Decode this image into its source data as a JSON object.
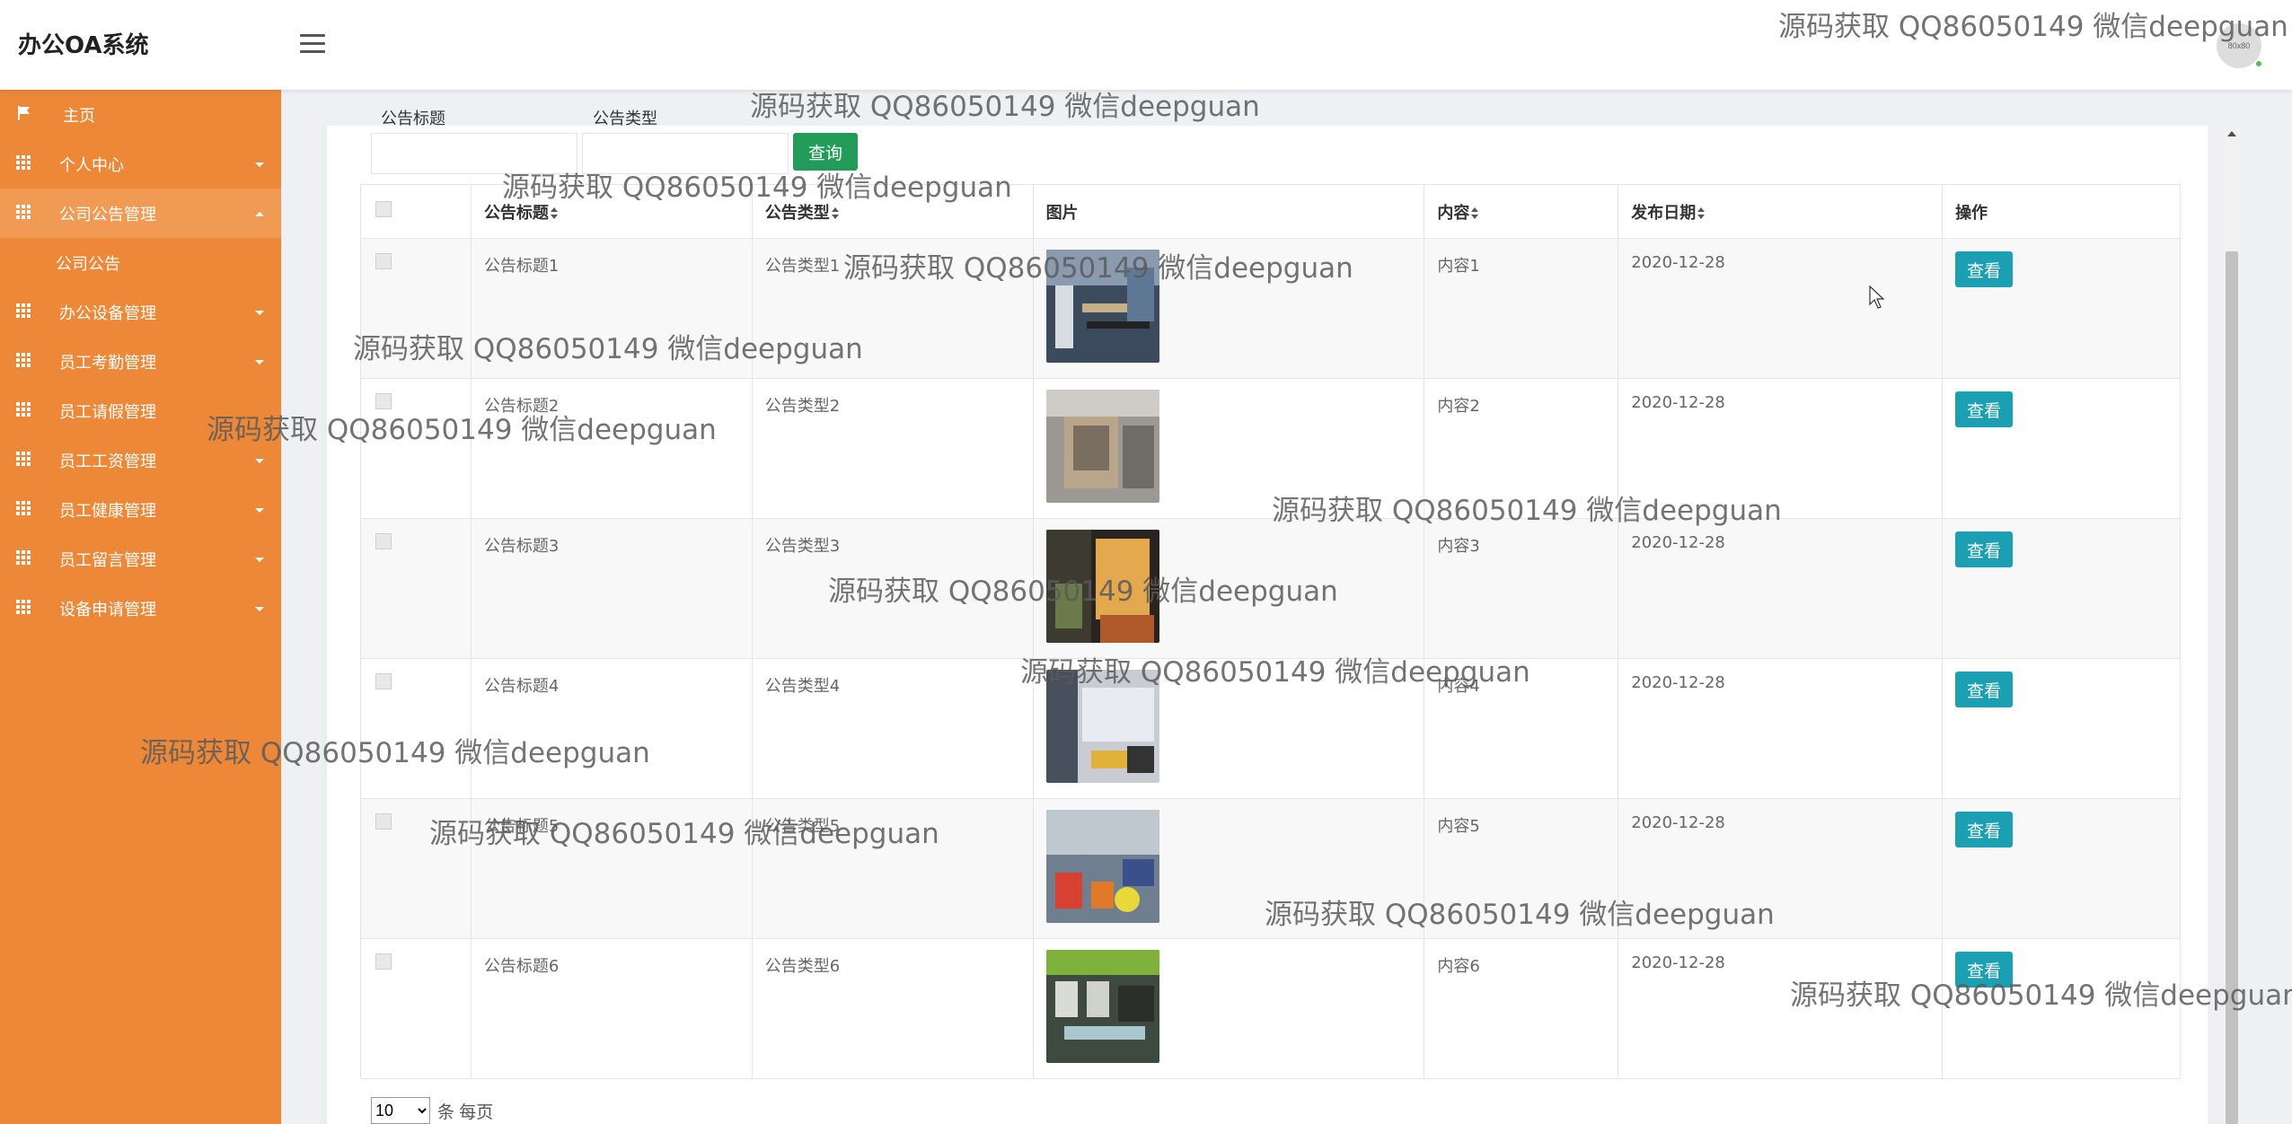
{
  "app": {
    "title": "办公OA系统",
    "avatar_text": "80x80"
  },
  "sidebar": {
    "items": [
      {
        "label": "主页",
        "icon": "flag-icon",
        "expandable": false,
        "active": false
      },
      {
        "label": "个人中心",
        "icon": "grid-icon",
        "expandable": true,
        "active": false
      },
      {
        "label": "公司公告管理",
        "icon": "grid-icon",
        "expandable": true,
        "active": true,
        "expanded": true
      },
      {
        "label": "办公设备管理",
        "icon": "grid-icon",
        "expandable": true,
        "active": false
      },
      {
        "label": "员工考勤管理",
        "icon": "grid-icon",
        "expandable": true,
        "active": false
      },
      {
        "label": "员工请假管理",
        "icon": "grid-icon",
        "expandable": false,
        "active": false
      },
      {
        "label": "员工工资管理",
        "icon": "grid-icon",
        "expandable": true,
        "active": false
      },
      {
        "label": "员工健康管理",
        "icon": "grid-icon",
        "expandable": true,
        "active": false
      },
      {
        "label": "员工留言管理",
        "icon": "grid-icon",
        "expandable": true,
        "active": false
      },
      {
        "label": "设备申请管理",
        "icon": "grid-icon",
        "expandable": true,
        "active": false
      }
    ],
    "subitem": "公司公告"
  },
  "search": {
    "label1": "公告标题",
    "label2": "公告类型",
    "query_label": "查询"
  },
  "table": {
    "columns": [
      "公告标题",
      "公告类型",
      "图片",
      "内容",
      "发布日期",
      "操作"
    ],
    "rows": [
      {
        "title": "公告标题1",
        "type": "公告类型1",
        "content": "内容1",
        "date": "2020-12-28",
        "action": "查看"
      },
      {
        "title": "公告标题2",
        "type": "公告类型2",
        "content": "内容2",
        "date": "2020-12-28",
        "action": "查看"
      },
      {
        "title": "公告标题3",
        "type": "公告类型3",
        "content": "内容3",
        "date": "2020-12-28",
        "action": "查看"
      },
      {
        "title": "公告标题4",
        "type": "公告类型4",
        "content": "内容4",
        "date": "2020-12-28",
        "action": "查看"
      },
      {
        "title": "公告标题5",
        "type": "公告类型5",
        "content": "内容5",
        "date": "2020-12-28",
        "action": "查看"
      },
      {
        "title": "公告标题6",
        "type": "公告类型6",
        "content": "内容6",
        "date": "2020-12-28",
        "action": "查看"
      }
    ]
  },
  "pager": {
    "page_size": "10",
    "suffix": "条 每页"
  },
  "watermark": "源码获取 QQ86050149 微信deepguan",
  "colors": {
    "sidebar": "#ec8838",
    "sidebar_active": "#f09a53",
    "query_button": "#239c5a",
    "view_button": "#1ba0b3"
  }
}
